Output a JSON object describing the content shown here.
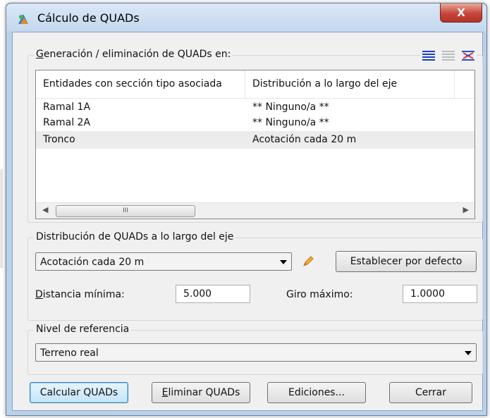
{
  "window": {
    "title": "Cálculo de QUADs",
    "close_label": "X"
  },
  "generation_group": {
    "label_prefix": "G",
    "label_rest": "eneración / eliminación de QUADs en:",
    "columns": [
      "Entidades con sección tipo asociada",
      "Distribución a lo largo del eje"
    ],
    "rows": [
      {
        "entity": "Ramal 1A",
        "distribution": "** Ninguno/a **"
      },
      {
        "entity": "Ramal 2A",
        "distribution": "** Ninguno/a **"
      },
      {
        "entity": "Tronco",
        "distribution": "Acotación cada 20 m"
      }
    ],
    "scroll_thumb_grip": "III",
    "icons": [
      "list-blue-icon",
      "list-grey-icon",
      "distribution-icon"
    ]
  },
  "distribution_group": {
    "label": "Distribución de QUADs a lo largo del eje",
    "selected": "Acotación cada 20 m",
    "default_button": "Establecer por defecto",
    "min_distance_label_prefix": "D",
    "min_distance_label_rest": "istancia mínima:",
    "min_distance_value": "5.000",
    "max_turn_label": "Giro máximo:",
    "max_turn_value": "1.0000"
  },
  "reference_group": {
    "label": "Nivel de referencia",
    "selected": "Terreno real"
  },
  "buttons": {
    "calculate": "Calcular QUADs",
    "delete_prefix": "E",
    "delete_rest": "liminar QUADs",
    "editions": "Ediciones...",
    "close": "Cerrar"
  },
  "colors": {
    "titlebar": "#c3d7ee",
    "close_button": "#c7453a",
    "dialog_bg": "#f0f0f0"
  }
}
